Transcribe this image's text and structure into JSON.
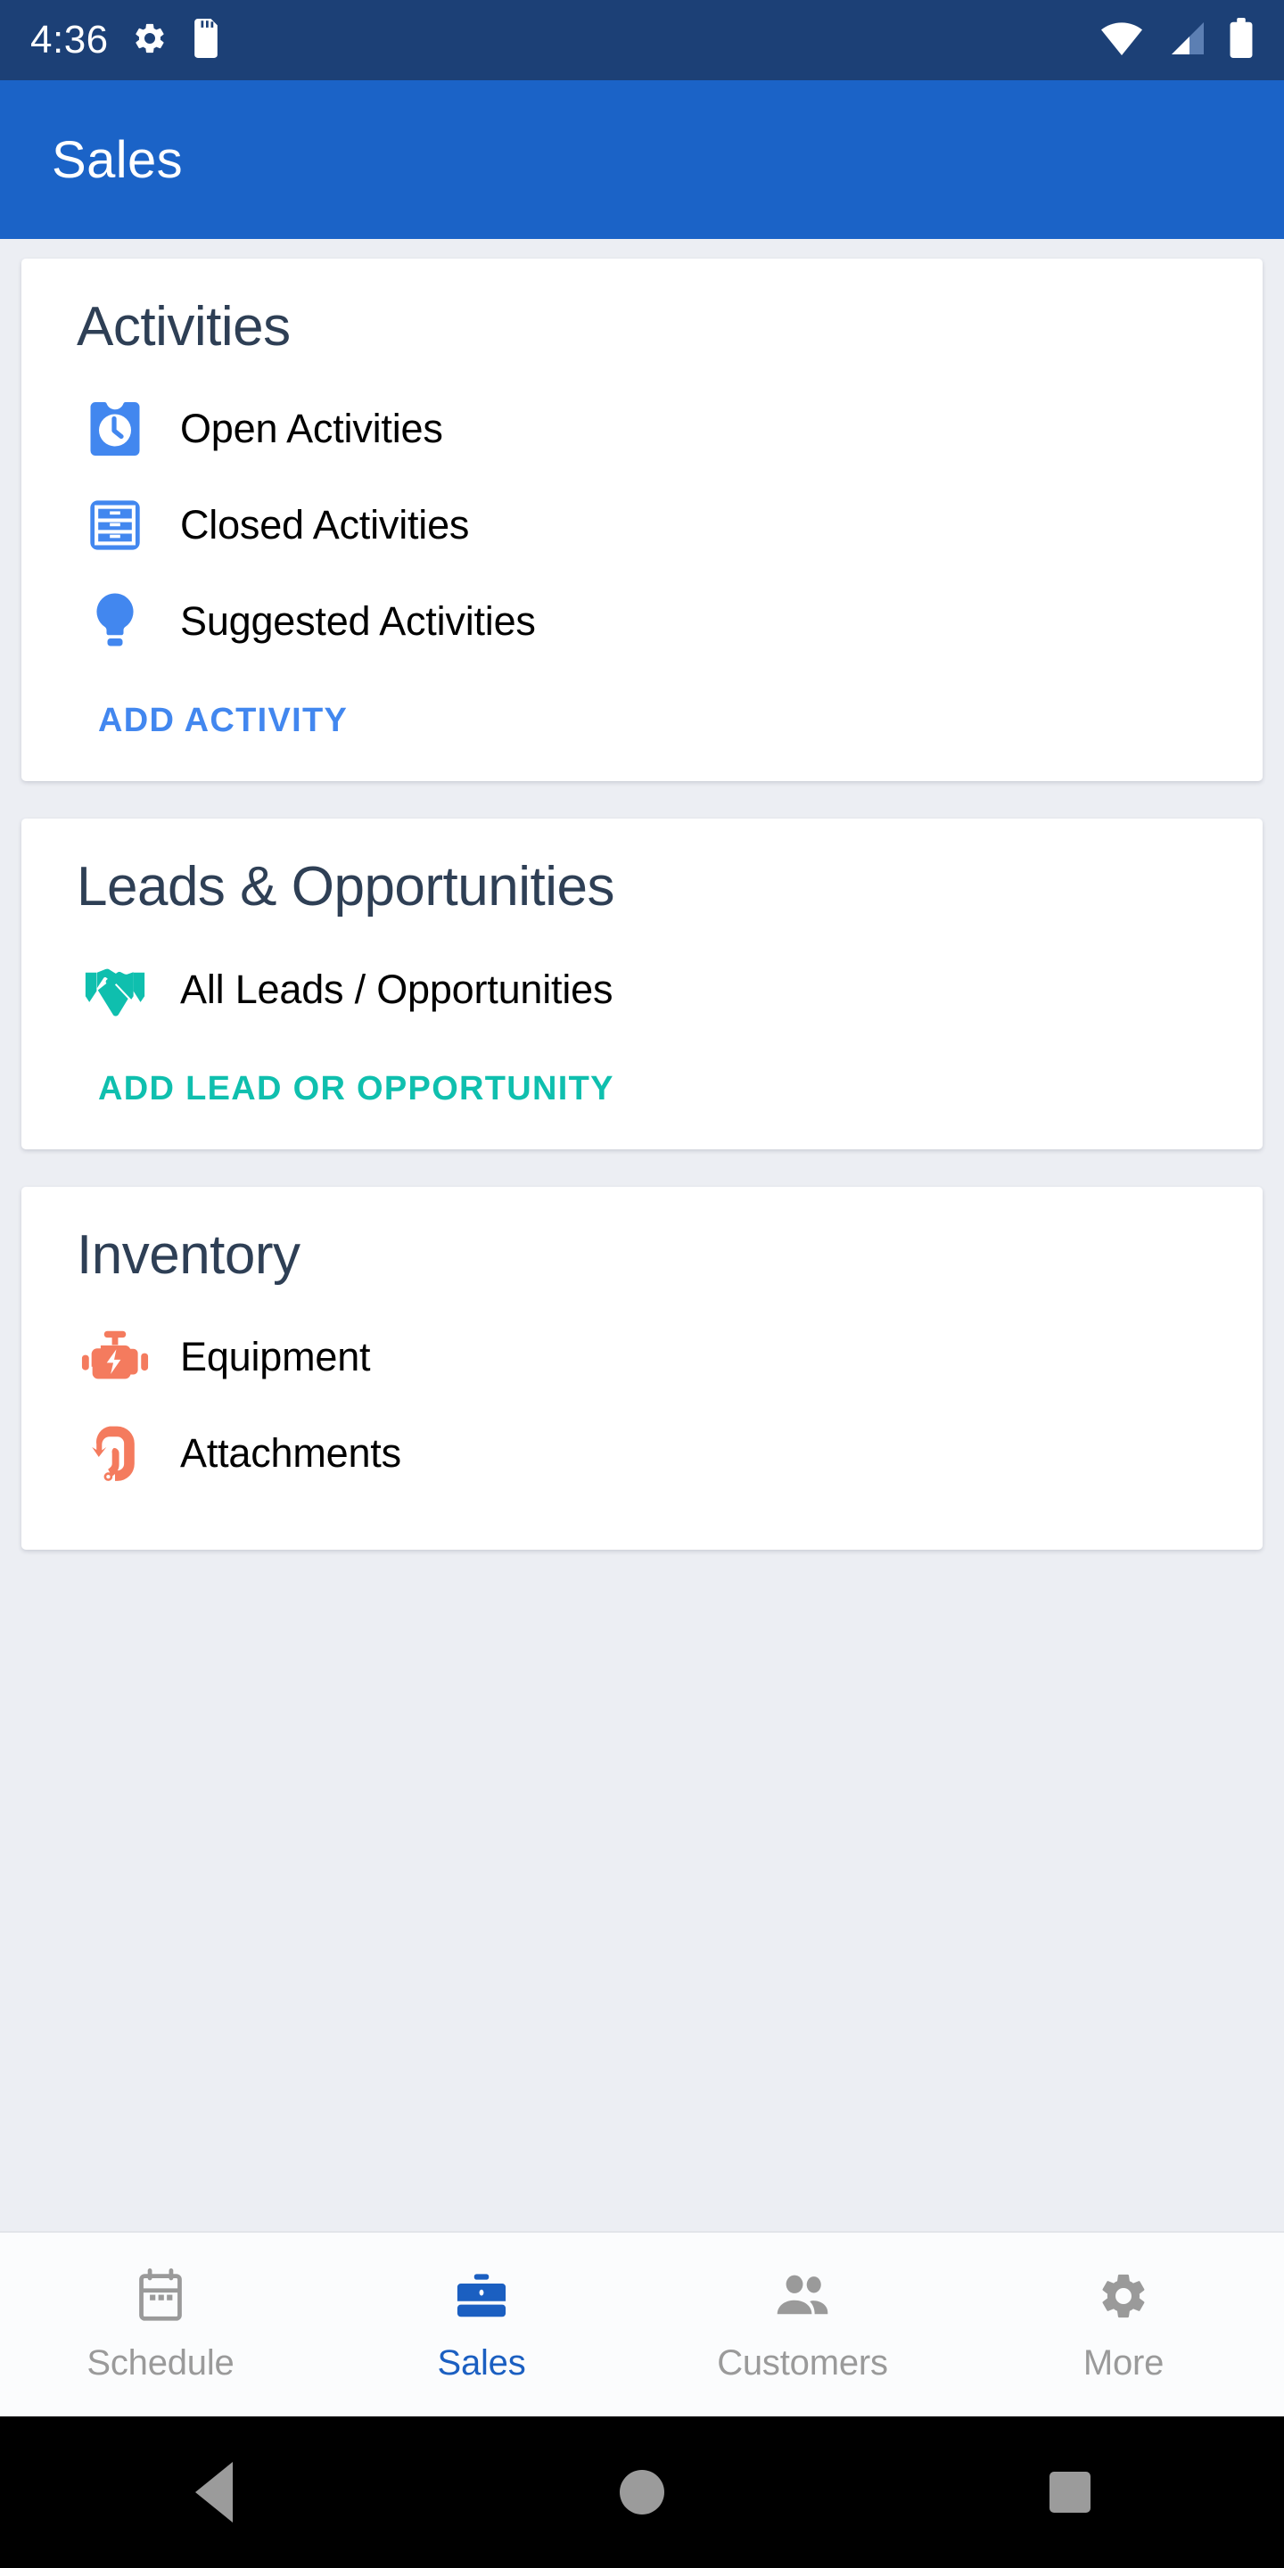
{
  "status_bar": {
    "time": "4:36",
    "left_icons": [
      "gear-icon",
      "sd-card-icon"
    ],
    "right_icons": [
      "wifi-icon",
      "cellular-signal-icon",
      "battery-icon"
    ],
    "background_color": "#1c4076"
  },
  "app_bar": {
    "title": "Sales",
    "background_color": "#1b63c7"
  },
  "cards": [
    {
      "title": "Activities",
      "accent_color": "#4287ef",
      "items": [
        {
          "label": "Open Activities",
          "icon": "clock-badge-icon"
        },
        {
          "label": "Closed Activities",
          "icon": "file-cabinet-icon"
        },
        {
          "label": "Suggested Activities",
          "icon": "lightbulb-icon"
        }
      ],
      "action": "ADD ACTIVITY"
    },
    {
      "title": "Leads & Opportunities",
      "accent_color": "#0fbfae",
      "items": [
        {
          "label": "All Leads / Opportunities",
          "icon": "handshake-icon"
        }
      ],
      "action": "ADD LEAD OR OPPORTUNITY"
    },
    {
      "title": "Inventory",
      "accent_color": "#f47b5e",
      "items": [
        {
          "label": "Equipment",
          "icon": "engine-icon"
        },
        {
          "label": "Attachments",
          "icon": "hook-icon"
        }
      ],
      "action": ""
    }
  ],
  "bottom_nav": {
    "active_index": 1,
    "active_color": "#1b5fc1",
    "inactive_color": "#9a9a9a",
    "items": [
      {
        "label": "Schedule",
        "icon": "calendar-icon"
      },
      {
        "label": "Sales",
        "icon": "briefcase-icon"
      },
      {
        "label": "Customers",
        "icon": "people-icon"
      },
      {
        "label": "More",
        "icon": "gear-icon"
      }
    ]
  },
  "system_nav": {
    "buttons": [
      {
        "name": "back",
        "icon": "triangle-back-icon"
      },
      {
        "name": "home",
        "icon": "circle-home-icon"
      },
      {
        "name": "recents",
        "icon": "square-recents-icon"
      }
    ]
  }
}
